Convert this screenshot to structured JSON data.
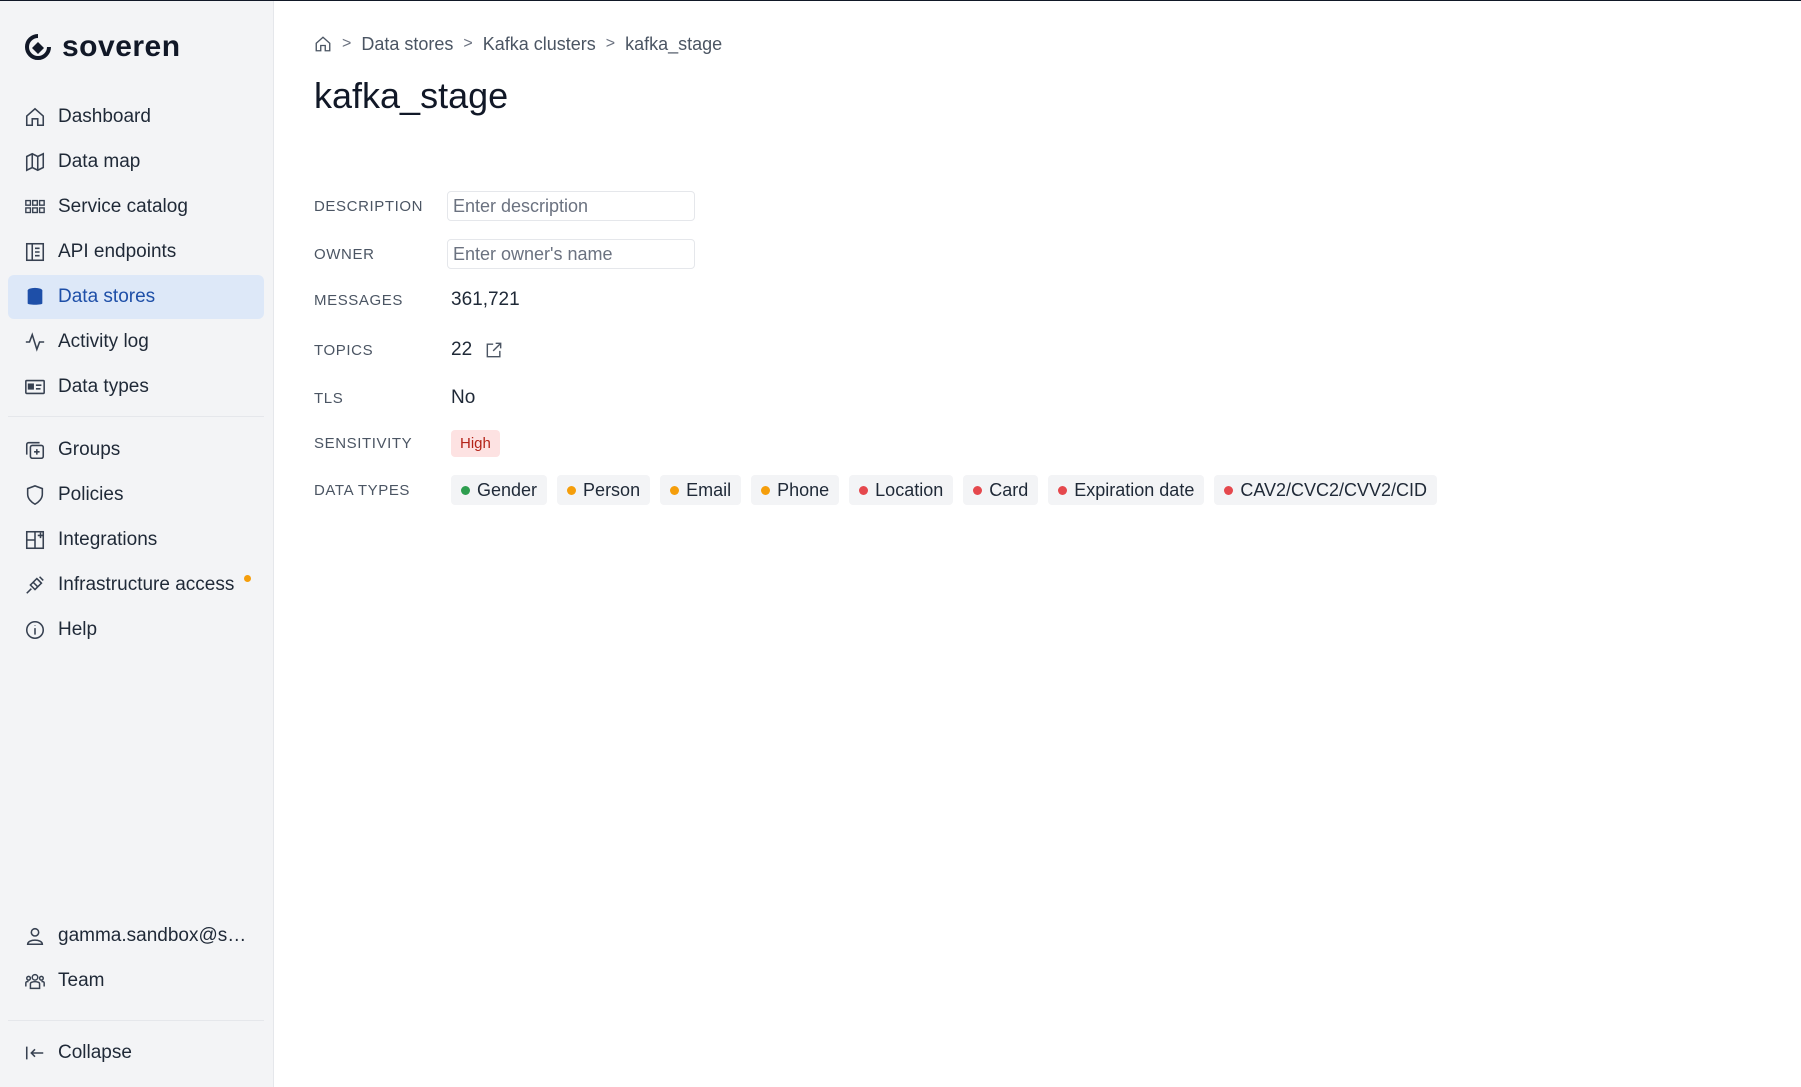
{
  "app": {
    "logo_text": "soveren"
  },
  "nav": {
    "primary": [
      {
        "label": "Dashboard",
        "icon": "home-icon"
      },
      {
        "label": "Data map",
        "icon": "map-icon"
      },
      {
        "label": "Service catalog",
        "icon": "grid-icon"
      },
      {
        "label": "API endpoints",
        "icon": "api-endpoints-icon"
      },
      {
        "label": "Data stores",
        "icon": "database-icon",
        "active": true
      },
      {
        "label": "Activity log",
        "icon": "activity-icon"
      },
      {
        "label": "Data types",
        "icon": "id-card-icon"
      }
    ],
    "secondary": [
      {
        "label": "Groups",
        "icon": "groups-icon"
      },
      {
        "label": "Policies",
        "icon": "shield-icon"
      },
      {
        "label": "Integrations",
        "icon": "integrations-icon"
      },
      {
        "label": "Infrastructure access",
        "icon": "plug-icon",
        "notification": true
      },
      {
        "label": "Help",
        "icon": "info-icon"
      }
    ],
    "footer": [
      {
        "label": "gamma.sandbox@so...",
        "icon": "user-icon"
      },
      {
        "label": "Team",
        "icon": "team-icon"
      }
    ],
    "collapse": {
      "label": "Collapse",
      "icon": "collapse-icon"
    }
  },
  "breadcrumb": [
    "Data stores",
    "Kafka clusters",
    "kafka_stage"
  ],
  "page": {
    "title": "kafka_stage"
  },
  "fields": {
    "description": {
      "label": "DESCRIPTION",
      "placeholder": "Enter description",
      "value": ""
    },
    "owner": {
      "label": "OWNER",
      "placeholder": "Enter owner's name",
      "value": ""
    },
    "messages": {
      "label": "MESSAGES",
      "value": "361,721"
    },
    "topics": {
      "label": "TOPICS",
      "value": "22"
    },
    "tls": {
      "label": "TLS",
      "value": "No"
    },
    "sensitivity": {
      "label": "SENSITIVITY",
      "value": "High"
    },
    "data_types": {
      "label": "DATA TYPES",
      "items": [
        {
          "label": "Gender",
          "color": "#2e9e4f"
        },
        {
          "label": "Person",
          "color": "#f59e0b"
        },
        {
          "label": "Email",
          "color": "#f59e0b"
        },
        {
          "label": "Phone",
          "color": "#f59e0b"
        },
        {
          "label": "Location",
          "color": "#e5484d"
        },
        {
          "label": "Card",
          "color": "#e5484d"
        },
        {
          "label": "Expiration date",
          "color": "#e5484d"
        },
        {
          "label": "CAV2/CVC2/CVV2/CID",
          "color": "#e5484d"
        }
      ]
    }
  },
  "colors": {
    "accent": "#1e4fa8",
    "active_bg": "#dde8f8",
    "sensitivity_high_bg": "#fde2e2",
    "sensitivity_high_text": "#b42318"
  }
}
